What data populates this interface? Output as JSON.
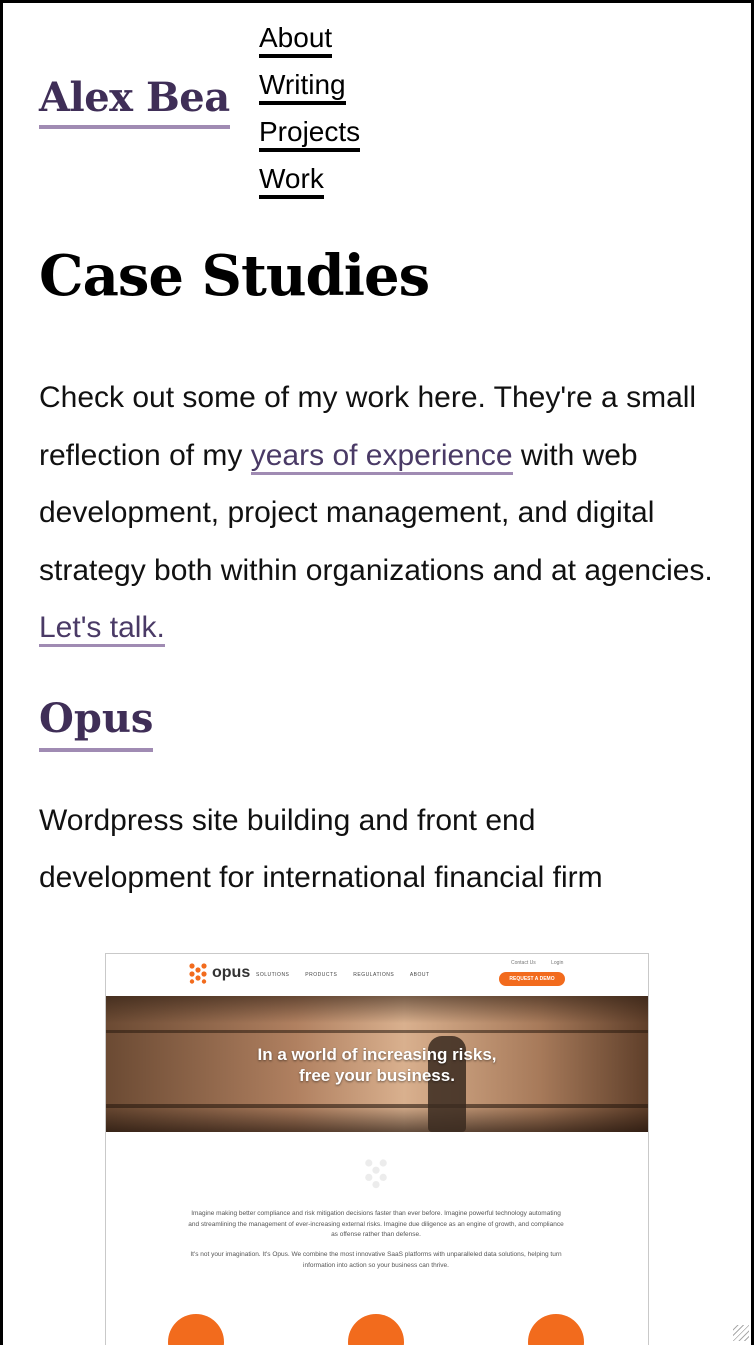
{
  "site": {
    "title": "Alex Bea"
  },
  "nav": {
    "items": [
      {
        "label": "About"
      },
      {
        "label": "Writing"
      },
      {
        "label": "Projects"
      },
      {
        "label": "Work"
      }
    ]
  },
  "page": {
    "heading": "Case Studies",
    "intro": {
      "before_link": "Check out some of my work here. They're a small reflection of my ",
      "experience_link": "years of experience",
      "after_link": " with web development, project management, and digital strategy both within organizations and at agencies. ",
      "talk_link": "Let's talk."
    }
  },
  "project": {
    "title": "Opus",
    "description": "Wordpress site building and front end development for international financial firm",
    "screenshot": {
      "logo_text": "opus",
      "nav": [
        "SOLUTIONS",
        "PRODUCTS",
        "REGULATIONS",
        "ABOUT"
      ],
      "utility": [
        "Contact Us",
        "Login"
      ],
      "cta": "REQUEST A DEMO",
      "hero_line1": "In a world of increasing risks,",
      "hero_line2": "free your business.",
      "body1": "Imagine making better compliance and risk mitigation decisions faster than ever before. Imagine powerful technology automating and streamlining the management of ever-increasing external risks. Imagine due diligence as an engine of growth, and compliance as offense rather than defense.",
      "body2": "It's not your imagination. It's Opus. We combine the most innovative SaaS platforms with unparalleled data solutions, helping turn information into action so your business can thrive.",
      "accent_color": "#f26b1d"
    }
  },
  "colors": {
    "accent": "#3f2e57",
    "underline": "#a08bb3",
    "text": "#111111"
  }
}
